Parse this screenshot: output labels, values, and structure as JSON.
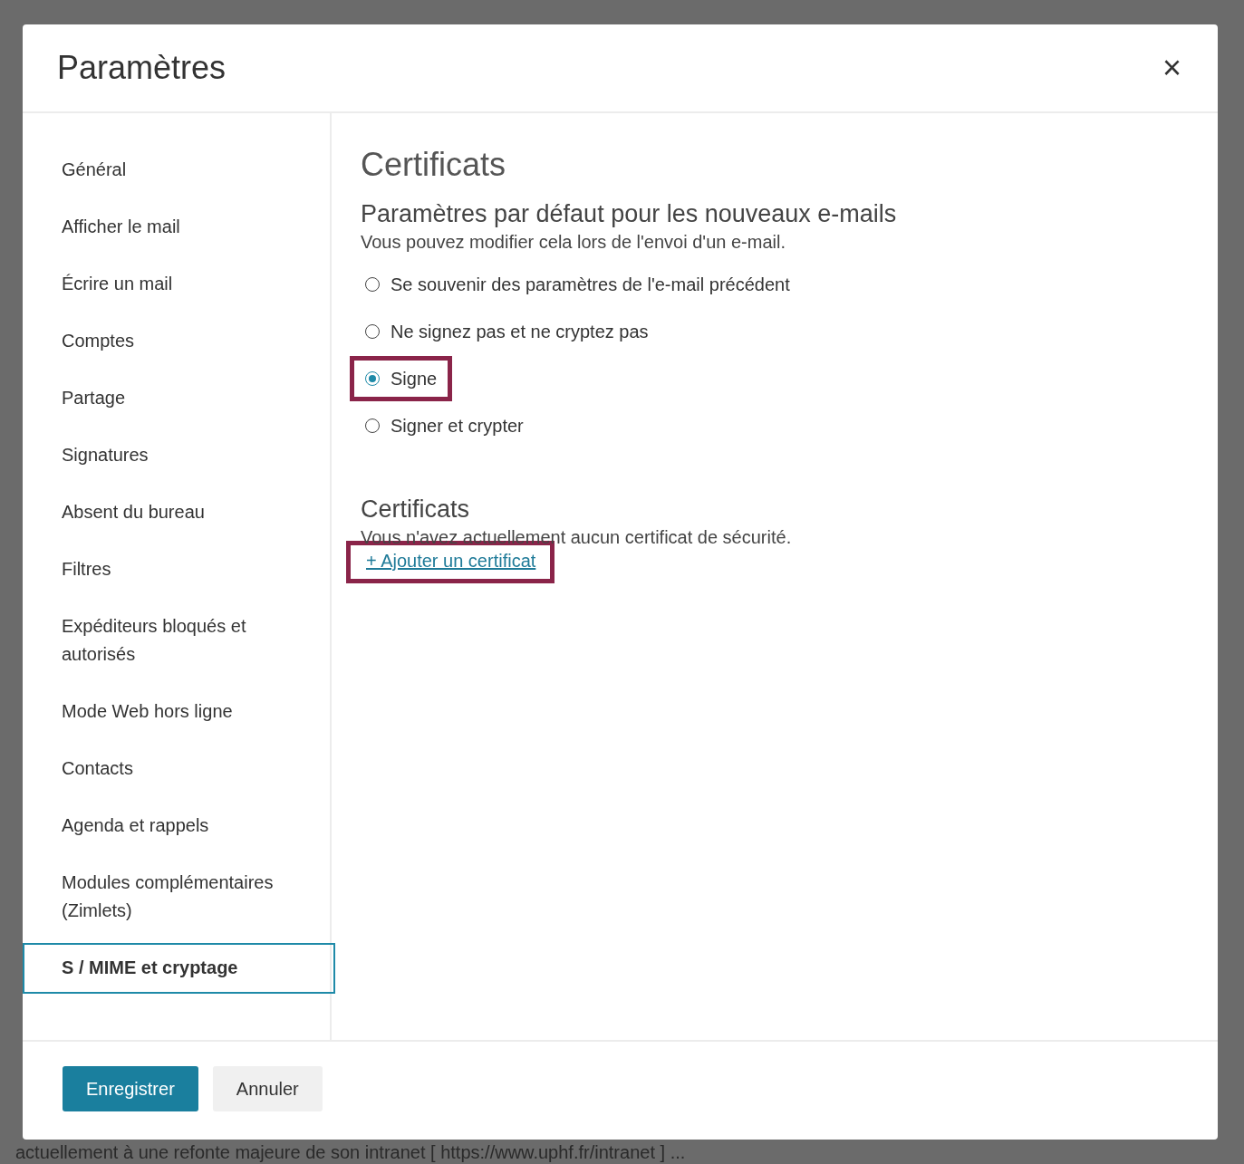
{
  "dialog": {
    "title": "Paramètres",
    "close": "×"
  },
  "sidebar": {
    "items": [
      {
        "label": "Général",
        "selected": false
      },
      {
        "label": "Afficher le mail",
        "selected": false
      },
      {
        "label": "Écrire un mail",
        "selected": false
      },
      {
        "label": "Comptes",
        "selected": false
      },
      {
        "label": "Partage",
        "selected": false
      },
      {
        "label": "Signatures",
        "selected": false
      },
      {
        "label": "Absent du bureau",
        "selected": false
      },
      {
        "label": "Filtres",
        "selected": false
      },
      {
        "label": "Expéditeurs bloqués et autorisés",
        "selected": false
      },
      {
        "label": "Mode Web hors ligne",
        "selected": false
      },
      {
        "label": "Contacts",
        "selected": false
      },
      {
        "label": "Agenda et rappels",
        "selected": false
      },
      {
        "label": "Modules complémentaires (Zimlets)",
        "selected": false
      },
      {
        "label": "S / MIME et cryptage",
        "selected": true
      }
    ]
  },
  "content": {
    "title": "Certificats",
    "defaults": {
      "heading": "Paramètres par défaut pour les nouveaux e-mails",
      "description": "Vous pouvez modifier cela lors de l'envoi d'un e-mail.",
      "options": [
        {
          "label": "Se souvenir des paramètres de l'e-mail précédent",
          "selected": false,
          "highlighted": false
        },
        {
          "label": "Ne signez pas et ne cryptez pas",
          "selected": false,
          "highlighted": false
        },
        {
          "label": "Signe",
          "selected": true,
          "highlighted": true
        },
        {
          "label": "Signer et crypter",
          "selected": false,
          "highlighted": false
        }
      ]
    },
    "certificates": {
      "heading": "Certificats",
      "description": "Vous n'avez actuellement aucun certificat de sécurité.",
      "link": {
        "label": "+ Ajouter un certificat",
        "highlighted": true
      }
    }
  },
  "buttons": [
    {
      "label": "Enregistrer",
      "kind": "primary"
    },
    {
      "label": "Annuler",
      "kind": "secondary"
    }
  ],
  "background_text": "actuellement à une refonte majeure de son intranet [ https://www.uphf.fr/intranet ] ..."
}
